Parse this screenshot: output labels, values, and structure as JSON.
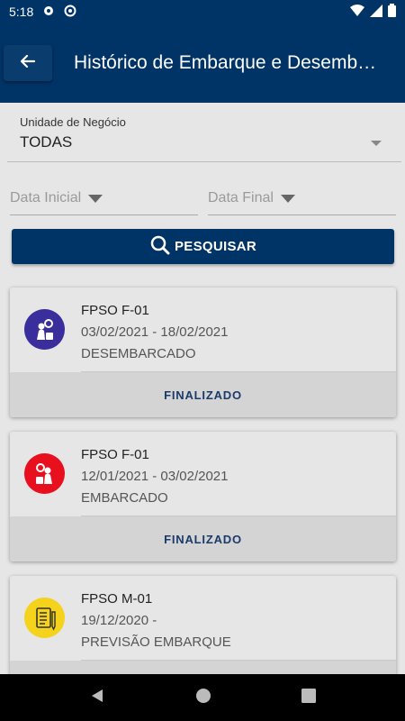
{
  "status_bar": {
    "time": "5:18"
  },
  "app_bar": {
    "title": "Histórico de Embarque e Desembarque"
  },
  "filters": {
    "business_unit_label": "Unidade de Negócio",
    "business_unit_value": "TODAS",
    "start_date_placeholder": "Data Inicial",
    "end_date_placeholder": "Data Final",
    "search_label": "PESQUISAR"
  },
  "cards": [
    {
      "unit": "FPSO F-01",
      "dates": "03/02/2021 - 18/02/2021",
      "status": "DESEMBARCADO",
      "action": "FINALIZADO",
      "icon": "disembark-person-icon",
      "color": "#3a2d9c"
    },
    {
      "unit": "FPSO F-01",
      "dates": "12/01/2021 - 03/02/2021",
      "status": "EMBARCADO",
      "action": "FINALIZADO",
      "icon": "embark-person-icon",
      "color": "#e8101e"
    },
    {
      "unit": "FPSO M-01",
      "dates": "19/12/2020 -",
      "status": "PREVISÃO EMBARQUE",
      "action": "",
      "icon": "checklist-icon",
      "color": "#f5d21b"
    }
  ]
}
